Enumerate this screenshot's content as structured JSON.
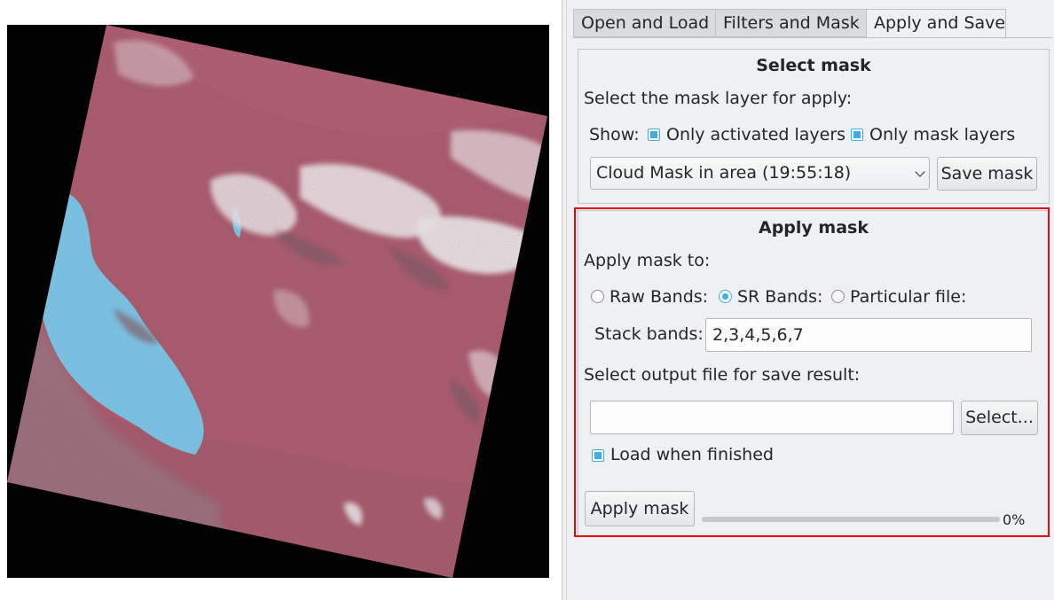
{
  "tabs": [
    {
      "label": "Open and Load",
      "active": false
    },
    {
      "label": "Filters and Mask",
      "active": false
    },
    {
      "label": "Apply and Save",
      "active": true
    }
  ],
  "select_mask": {
    "title": "Select mask",
    "instruction": "Select the mask layer for apply:",
    "show_label": "Show:",
    "only_activated_label": "Only activated layers",
    "only_activated_checked": true,
    "only_mask_label": "Only mask layers",
    "only_mask_checked": true,
    "mask_layer_selected": "Cloud Mask in area (19:55:18)",
    "save_mask_label": "Save mask"
  },
  "apply_mask": {
    "title": "Apply mask",
    "apply_to_label": "Apply mask to:",
    "raw_bands_label": "Raw Bands:",
    "sr_bands_label": "SR Bands:",
    "particular_file_label": "Particular file:",
    "selected_option": "SR Bands",
    "stack_bands_label": "Stack bands:",
    "stack_bands_value": "2,3,4,5,6,7",
    "output_label": "Select output file for save result:",
    "output_path": "",
    "select_button_label": "Select...",
    "load_when_finished_label": "Load when finished",
    "load_when_finished_checked": true,
    "apply_button_label": "Apply mask",
    "progress_value": 0,
    "progress_text": "0%"
  },
  "colors": {
    "accent": "#3daee9",
    "highlight": "#e8070b",
    "panel_bg": "#eff0f1",
    "image_land": "#a85466",
    "image_water": "#72cdf1",
    "image_cloud": "#f1f1f1",
    "nodata": "#000000"
  }
}
